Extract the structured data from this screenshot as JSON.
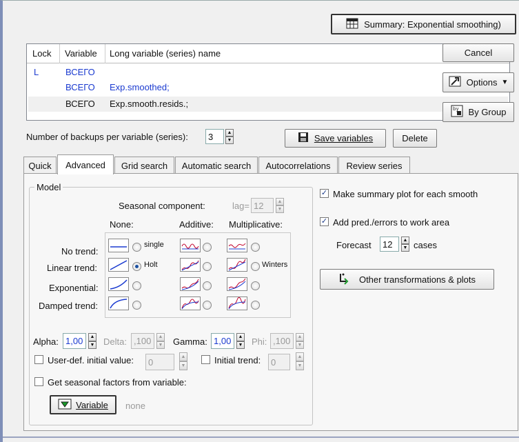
{
  "summary_button": "Summary:  Exponential smoothing)",
  "cancel_button": "Cancel",
  "options_button": "Options",
  "bygroup_button": "By Group",
  "table": {
    "headers": [
      "Lock",
      "Variable",
      "Long variable (series) name"
    ],
    "rows": [
      {
        "lock": "L",
        "variable": "ВСЕГО",
        "name": ""
      },
      {
        "lock": "",
        "variable": "ВСЕГО",
        "name": "Exp.smoothed;"
      },
      {
        "lock": "",
        "variable": "ВСЕГО",
        "name": "Exp.smooth.resids.;"
      }
    ]
  },
  "backups": {
    "label": "Number of backups per variable (series):",
    "value": "3"
  },
  "save_variables_button": "Save variables",
  "delete_button": "Delete",
  "tabs": [
    "Quick",
    "Advanced",
    "Grid search",
    "Automatic search",
    "Autocorrelations",
    "Review series"
  ],
  "model": {
    "group_title": "Model",
    "seasonal_label": "Seasonal component:",
    "lag_label": "lag=",
    "lag_value": "12",
    "col_none": "None:",
    "col_additive": "Additive:",
    "col_multiplicative": "Multiplicative:",
    "rows": [
      "No trend:",
      "Linear trend:",
      "Exponential:",
      "Damped trend:"
    ],
    "single_label": "single",
    "holt_label": "Holt",
    "winters_label": "Winters"
  },
  "params": {
    "alpha_label": "Alpha:",
    "alpha_value": "1,00",
    "delta_label": "Delta:",
    "delta_value": ",100",
    "gamma_label": "Gamma:",
    "gamma_value": "1,00",
    "phi_label": "Phi:",
    "phi_value": ",100"
  },
  "user_initial": {
    "label": "User-def. initial value:",
    "value": "0"
  },
  "initial_trend": {
    "label": "Initial trend:",
    "value": "0"
  },
  "seasonal_factors_label": "Get seasonal factors from variable:",
  "variable_button": "Variable",
  "variable_value": "none",
  "right": {
    "summary_plot_label": "Make summary plot for each smooth",
    "add_pred_label": "Add pred./errors to work area",
    "forecast_label": "Forecast",
    "forecast_value": "12",
    "cases_label": "cases",
    "other_button": "Other transformations & plots"
  },
  "colors": {
    "accent_text": "#1a3ad0",
    "frame": "#7f8fb8"
  }
}
